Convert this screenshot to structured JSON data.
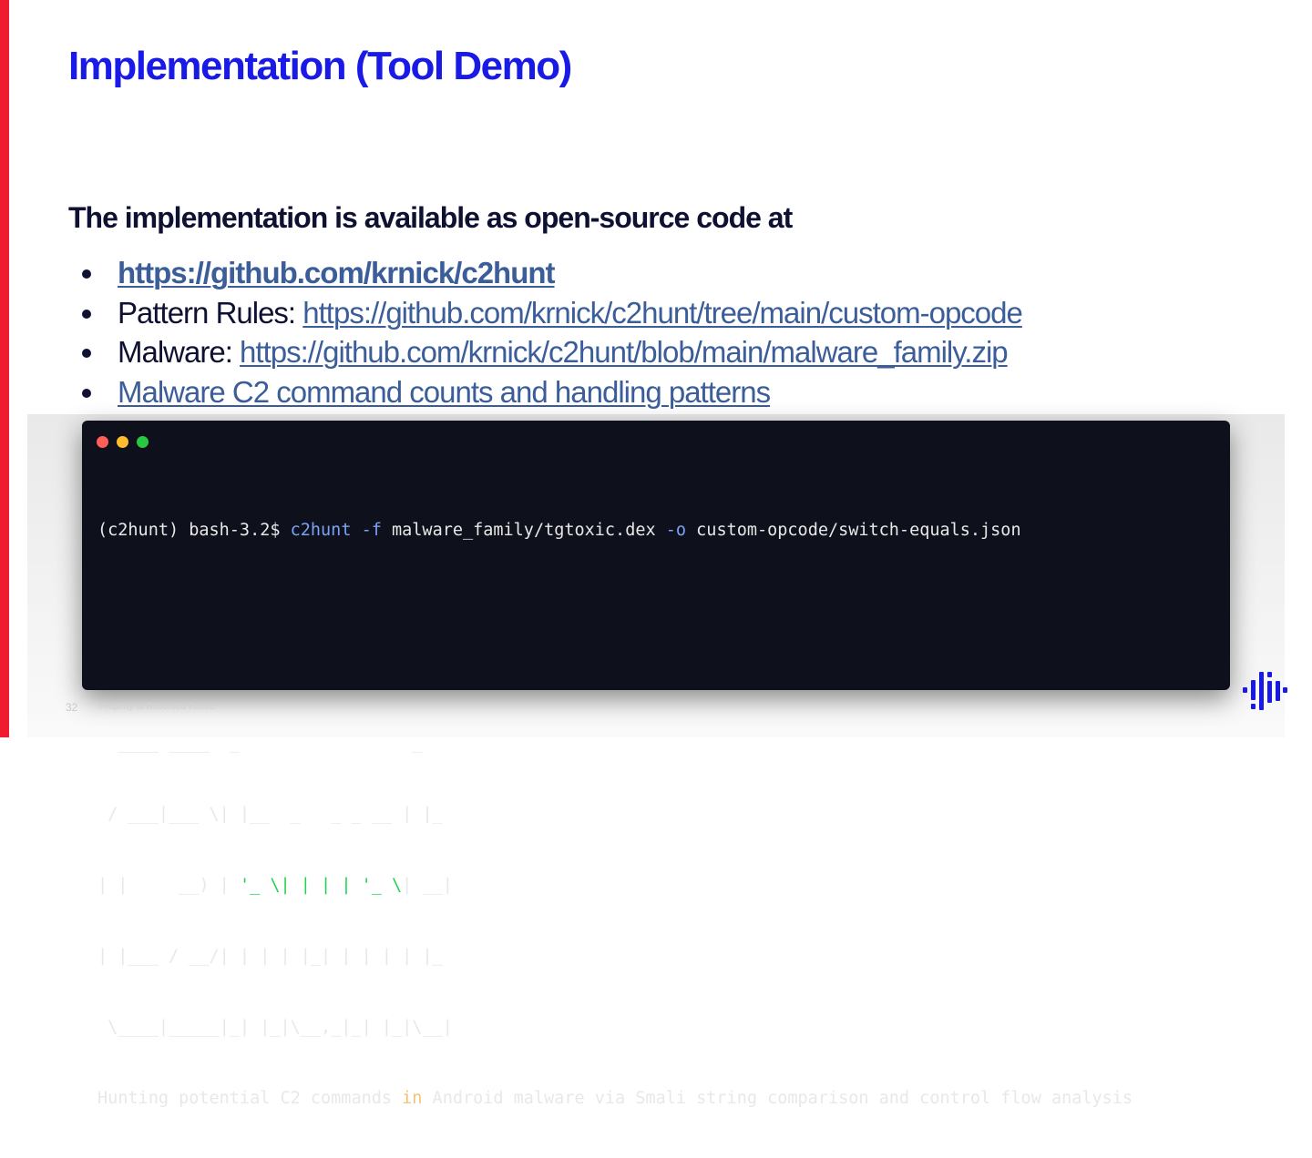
{
  "slide": {
    "title": "Implementation (Tool Demo)",
    "intro": "The implementation is available as open-source code at",
    "bullets": [
      {
        "label": "",
        "link": "https://github.com/krnick/c2hunt"
      },
      {
        "label": "Pattern Rules: ",
        "link": "https://github.com/krnick/c2hunt/tree/main/custom-opcode"
      },
      {
        "label": "Malware: ",
        "link": "https://github.com/krnick/c2hunt/blob/main/malware_family.zip"
      },
      {
        "label": "",
        "link": "Malware C2 command counts and handling patterns"
      }
    ],
    "page_number": "32",
    "footer_note": "Property of Recorded Future"
  },
  "terminal": {
    "prompt": "(c2hunt) bash-3.2$ ",
    "command": "c2hunt",
    "flag_f": "-f",
    "arg_f": "malware_family/tgtoxic.dex",
    "flag_o": "-o",
    "arg_o": "custom-opcode/switch-equals.json",
    "banner": {
      "line1": "  ____ ____  _                 _",
      "line2": " / ___|___ \\| |__  _   _ _ __ | |_",
      "line3_a": "| |     __) | ",
      "line3_b": "'_ \\| | | | '_ \\",
      "line3_c": "| __|",
      "line4": "| |___ / __/| | | | |_| | | | | |_",
      "line5": " \\____|_____|_| |_|\\__,_|_| |_|\\__|"
    },
    "tagline_a": "Hunting potential C2 commands ",
    "tagline_in": "in",
    "tagline_b": " Android malware via Smali string comparison and control flow analysis"
  },
  "colors": {
    "accent_red": "#ee1c2e",
    "title_blue": "#1a1ae6",
    "link_blue": "#3b5d9a",
    "terminal_bg": "#0e111c"
  },
  "icons": [
    "window-close-dot",
    "window-minimize-dot",
    "window-zoom-dot",
    "recorded-future-logo-icon"
  ]
}
